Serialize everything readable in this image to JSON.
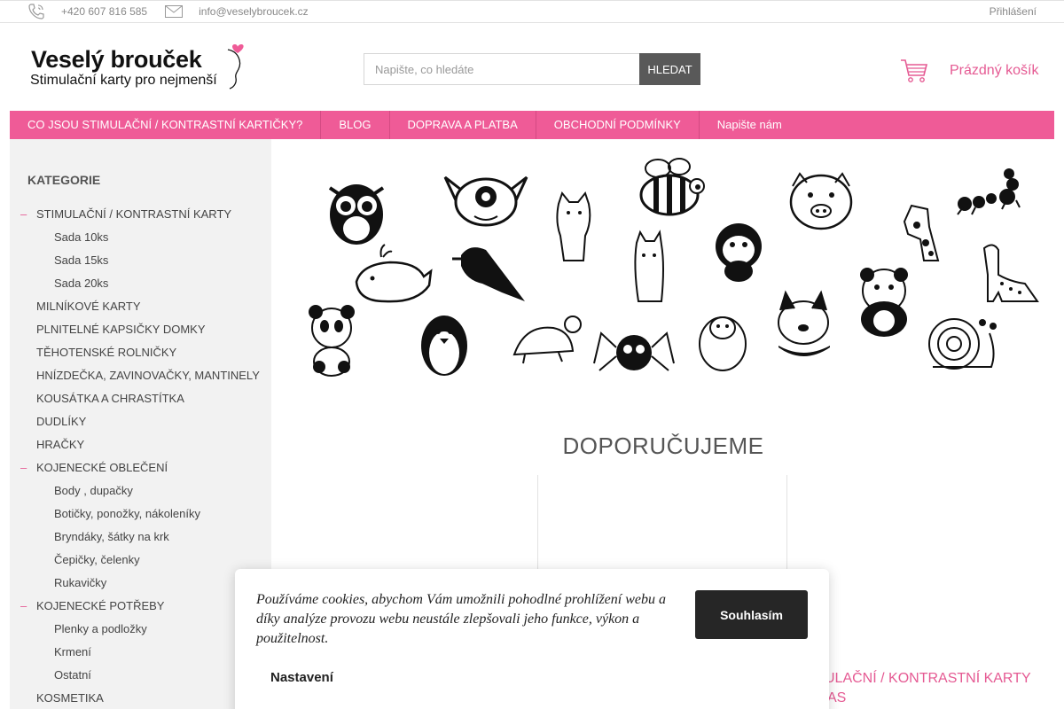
{
  "topbar": {
    "phone": "+420 607 816 585",
    "email": "info@veselybroucek.cz",
    "login": "Přihlášení"
  },
  "logo": {
    "line1": "Veselý brouček",
    "line2": "Stimulační karty pro nejmenší"
  },
  "search": {
    "placeholder": "Napište, co hledáte",
    "button": "HLEDAT"
  },
  "cart": {
    "label": "Prázdný košík"
  },
  "nav": {
    "items": [
      "CO JSOU STIMULAČNÍ / KONTRASTNÍ KARTIČKY?",
      "BLOG",
      "DOPRAVA A PLATBA",
      "OBCHODNÍ PODMÍNKY",
      "Napište nám"
    ]
  },
  "sidebar": {
    "title": "KATEGORIE",
    "items": [
      "STIMULAČNÍ / KONTRASTNÍ KARTY",
      "Sada 10ks",
      "Sada 15ks",
      "Sada 20ks",
      "MILNÍKOVÉ KARTY",
      "PLNITELNÉ KAPSIČKY DOMKY",
      "TĚHOTENSKÉ ROLNIČKY",
      "HNÍZDEČKA, ZAVINOVAČKY, MANTINELY",
      "KOUSÁTKA A CHRASTÍTKA",
      "DUDLÍKY",
      "HRAČKY",
      "KOJENECKÉ OBLEČENÍ",
      "Body , dupačky",
      "Botičky, ponožky, nákoleníky",
      "Bryndáky, šátky na krk",
      "Čepičky, čelenky",
      "Rukavičky",
      "KOJENECKÉ POTŘEBY",
      "Plenky a podložky",
      "Krmení",
      "Ostatní",
      "KOSMETIKA"
    ],
    "expanded_marker": "–"
  },
  "main": {
    "section_title": "DOPORUČUJEME",
    "product_title_line1": "ULAČNÍ / KONTRASTNÍ KARTY",
    "product_title_line2": "AS"
  },
  "cookie": {
    "text": "Používáme cookies, abychom Vám umožnili pohodlné prohlížení webu a díky analýze provozu webu neustále zlepšovali jeho funkce, výkon a použitelnost.",
    "agree": "Souhlasím",
    "settings": "Nastavení"
  },
  "colors": {
    "brand_pink": "#ef5b97",
    "link_pink": "#e55a93",
    "sidebar_bg": "#f2f2f2",
    "dark_button": "#262626"
  }
}
